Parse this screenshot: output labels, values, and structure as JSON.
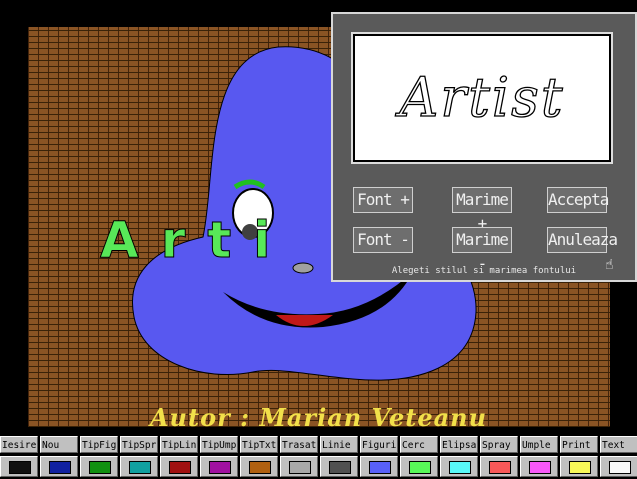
{
  "canvas": {
    "artwork_text": "Arti",
    "author_line": "Autor : Marian Veteanu"
  },
  "dialog": {
    "preview_text": "Artist",
    "buttons": {
      "font_plus": "Font +",
      "size_plus": "Marime +",
      "accept": "Accepta",
      "font_minus": "Font -",
      "size_minus": "Marime -",
      "cancel": "Anuleaza"
    },
    "hint": "Alegeti stilul si marimea fontului"
  },
  "toolbar": {
    "tools": [
      {
        "label": "Iesire",
        "color": "#101010"
      },
      {
        "label": "Nou",
        "color": "#1020a0"
      },
      {
        "label": "TipFig",
        "color": "#109010"
      },
      {
        "label": "TipSpr",
        "color": "#10a0a0"
      },
      {
        "label": "TipLin",
        "color": "#a01010"
      },
      {
        "label": "TipUmp",
        "color": "#a010a0"
      },
      {
        "label": "TipTxt",
        "color": "#b06010"
      },
      {
        "label": "Trasat",
        "color": "#a8a8a8"
      },
      {
        "label": "Linie",
        "color": "#505050"
      },
      {
        "label": "Figuri",
        "color": "#5860f8"
      },
      {
        "label": "Cerc",
        "color": "#58f858"
      },
      {
        "label": "Elipsa",
        "color": "#58f8f8"
      },
      {
        "label": "Spray",
        "color": "#f85858"
      },
      {
        "label": "Umple",
        "color": "#f858f8"
      },
      {
        "label": "Print",
        "color": "#f8f858"
      },
      {
        "label": "Text",
        "color": "#f8f8f8"
      }
    ]
  },
  "colors": {
    "blob": "#5858f0",
    "artwork_text": "#58e858",
    "author_text": "#f2e04a",
    "mouth_inner": "#c01818"
  }
}
